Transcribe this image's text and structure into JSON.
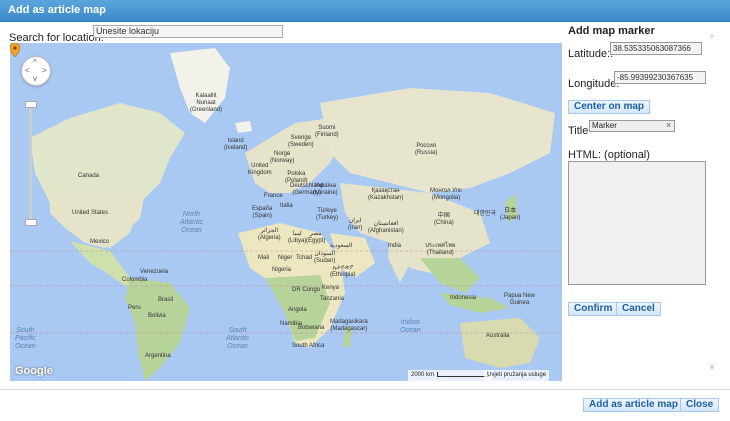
{
  "dialog": {
    "title": "Add as article map"
  },
  "search": {
    "label": "Search for location:",
    "value": "Unesite lokaciju"
  },
  "map": {
    "pan_symbols": {
      "up": "^",
      "down": "v",
      "left": "<",
      "right": ">"
    },
    "logo": "Google",
    "scale": "2000 km",
    "terms": "Uvjeti pružanja usluge",
    "labels": {
      "kalaallit": "Kalaallit\nNunaat\n(Greenland)",
      "iceland": "Island\n(Iceland)",
      "sverige": "Sverige\n(Sweden)",
      "suomi": "Suomi\n(Finland)",
      "norge": "Norge\n(Norway)",
      "russia": "Россия\n(Russia)",
      "canada": "Canada",
      "uk": "United\nKingdom",
      "poland": "Polska\n(Poland)",
      "germany": "Deutschland\n(Germany)",
      "ukraine": "Україна\n(Ukraine)",
      "france": "France",
      "kazakhstan": "Қазақстан\n(Kazakhstan)",
      "mongolia": "Монгол Улс\n(Mongolia)",
      "spain": "España\n(Spain)",
      "italy": "Italia",
      "turkey": "Türkiye\n(Turkey)",
      "usa": "United States",
      "iran": "ایران\n(Iran)",
      "afghanistan": "افغانستان\n(Afghanistan)",
      "china": "中国\n(China)",
      "japan": "日本\n(Japan)",
      "korea": "대한민국",
      "algeria": "الجزائر\n(Algeria)",
      "libya": "ليبيا\n(Libya)",
      "egypt": "مصر\n(Egypt)",
      "mexico": "Mexico",
      "saudi": "السعودية",
      "india": "India",
      "thailand": "ประเทศไทย\n(Thailand)",
      "mali": "Mali",
      "niger": "Niger",
      "chad": "Tchad",
      "sudan": "السودان\n(Sudan)",
      "nigeria": "Nigeria",
      "ethiopia": "ኢትዮጵያ\n(Ethiopia)",
      "venezuela": "Venezuela",
      "colombia": "Colombia",
      "drc": "DR Congo",
      "kenya": "Kenya",
      "tanzania": "Tanzania",
      "indonesia": "Indonesia",
      "png": "Papua New\nGuinea",
      "brasil": "Brasil",
      "peru": "Peru",
      "bolivia": "Bolivia",
      "angola": "Angola",
      "namibia": "Namibia",
      "botswana": "Botswana",
      "madagascar": "Madagasikara\n(Madagascar)",
      "south_africa": "South Africa",
      "australia": "Australia",
      "argentina": "Argentina",
      "north_atlantic": "North\nAtlantic\nOcean",
      "south_atlantic": "South\nAtlantic\nOcean",
      "south_pacific": "South\nPacific\nOcean",
      "indian_ocean": "Indian\nOcean"
    }
  },
  "marker_panel": {
    "heading": "Add map marker",
    "latitude_label": "Latitude::",
    "latitude_value": "38.535335063087366",
    "longitude_label": "Longitude:",
    "longitude_value": "-85.99399230367635",
    "center_button": "Center on map",
    "title_label": "Title",
    "title_value": "Marker",
    "clear_symbol": "×",
    "html_label": "HTML: (optional)",
    "confirm": "Confirm",
    "cancel": "Cancel"
  },
  "scroll": {
    "up": "^",
    "down": "v"
  },
  "footer": {
    "add_button": "Add as article map",
    "close_button": "Close"
  },
  "colors": {
    "accent": "#3d89c6",
    "water": "#a9c8f2",
    "land": "#e5e3c9",
    "vegetation": "#b6d39a",
    "marker": "#f0a22a"
  }
}
